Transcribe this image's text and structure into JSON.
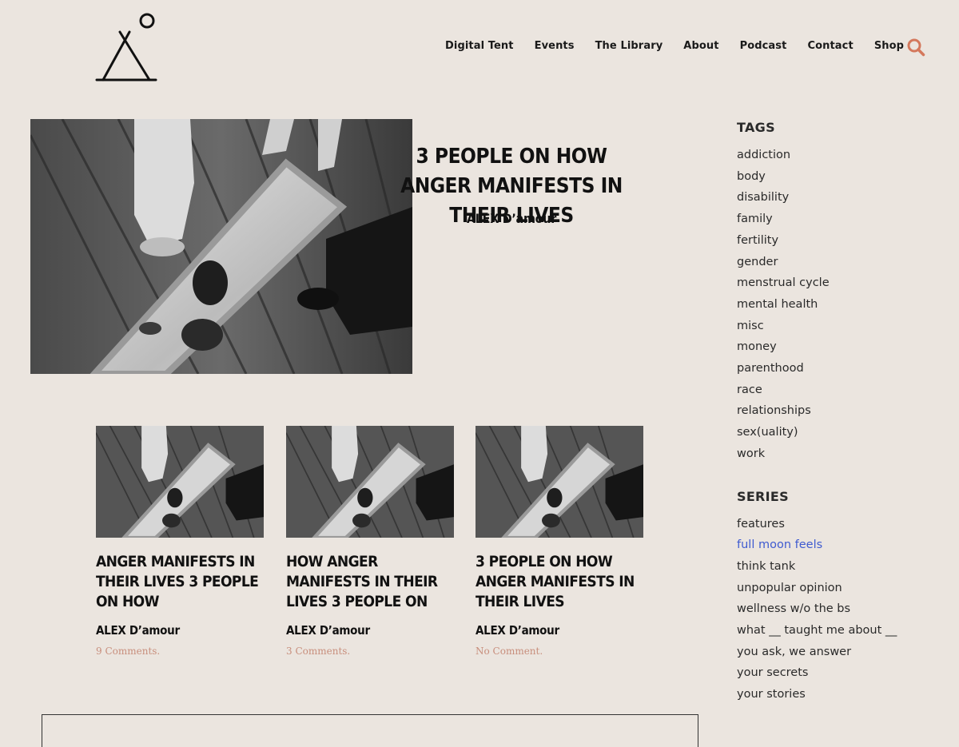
{
  "header": {
    "nav": [
      {
        "label": "Digital Tent",
        "name": "nav-digital-tent"
      },
      {
        "label": "Events",
        "name": "nav-events"
      },
      {
        "label": "The Library",
        "name": "nav-the-library"
      },
      {
        "label": "About",
        "name": "nav-about"
      },
      {
        "label": "Podcast",
        "name": "nav-podcast"
      },
      {
        "label": "Contact",
        "name": "nav-contact"
      },
      {
        "label": "Shop",
        "name": "nav-shop"
      }
    ],
    "search_icon": "search-icon",
    "accent_color": "#d4785c"
  },
  "featured": {
    "title": "3 PEOPLE ON HOW ANGER MANIFESTS IN THEIR LIVES",
    "author": "ALEX D’amour",
    "image": "mirror-photo"
  },
  "posts": [
    {
      "title": "ANGER MANIFESTS IN THEIR LIVES 3 PEOPLE ON HOW",
      "author": "ALEX D’amour",
      "comments": "9 Comments."
    },
    {
      "title": "HOW ANGER MANIFESTS IN THEIR LIVES 3 PEOPLE ON",
      "author": "ALEX D’amour",
      "comments": "3 Comments."
    },
    {
      "title": "3 PEOPLE ON HOW ANGER MANIFESTS IN THEIR LIVES",
      "author": "ALEX D’amour",
      "comments": "No Comment."
    }
  ],
  "sidebar": {
    "tags_heading": "TAGS",
    "tags": [
      "addiction",
      "body",
      "disability",
      "family",
      "fertility",
      "gender",
      "menstrual cycle",
      "mental health",
      "misc",
      "money",
      "parenthood",
      "race",
      "relationships",
      "sex(uality)",
      "work"
    ],
    "series_heading": "SERIES",
    "series": [
      "features",
      "full moon feels",
      "think tank",
      "unpopular opinion",
      "wellness w/o the bs",
      "what __ taught me about __",
      "you ask, we answer",
      "your secrets",
      "your stories"
    ],
    "active_series": "full moon feels",
    "link_active_color": "#3f5bd0"
  }
}
